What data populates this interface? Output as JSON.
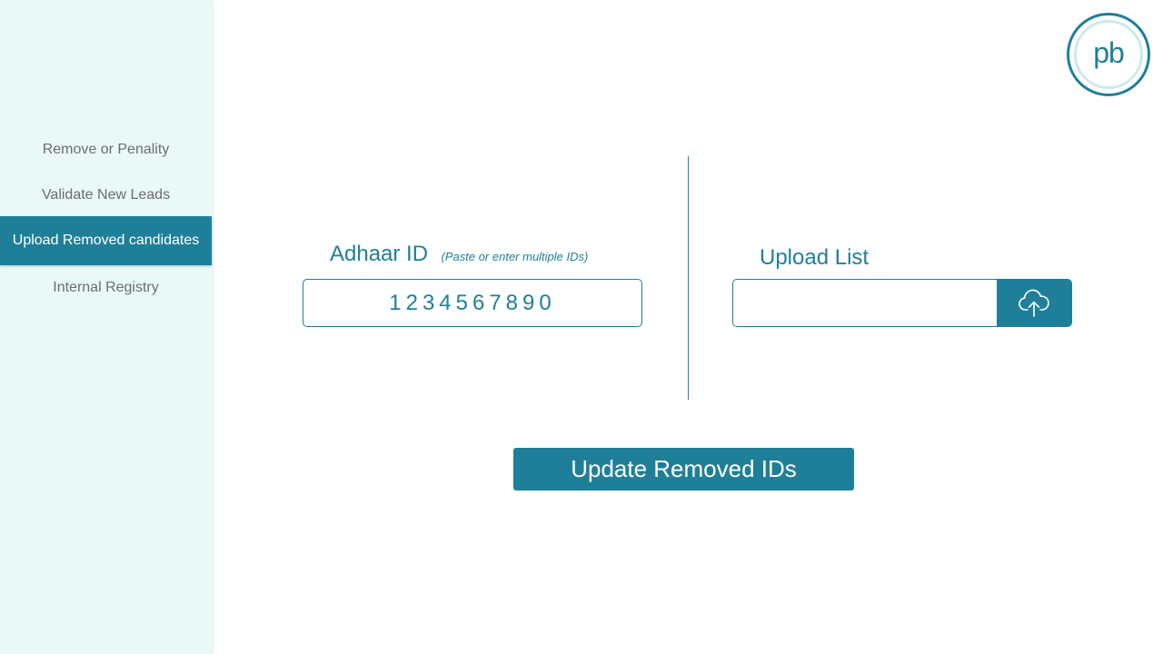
{
  "sidebar": {
    "items": [
      {
        "label": "Remove or Penality",
        "active": false
      },
      {
        "label": "Validate New Leads",
        "active": false
      },
      {
        "label": "Upload Removed candidates",
        "active": true
      },
      {
        "label": "Internal Registry",
        "active": false
      }
    ]
  },
  "logo": {
    "text": "pb"
  },
  "adhaar": {
    "label": "Adhaar ID",
    "hint": "(Paste or enter multiple IDs)",
    "value": "1234567890"
  },
  "upload": {
    "label": "Upload List",
    "value": "",
    "button_icon": "cloud-upload-icon"
  },
  "actions": {
    "update_label": "Update Removed IDs"
  },
  "colors": {
    "accent": "#1f7f98",
    "sidebar_bg": "#e9f8f9",
    "nav_text": "#6d6d6d"
  }
}
